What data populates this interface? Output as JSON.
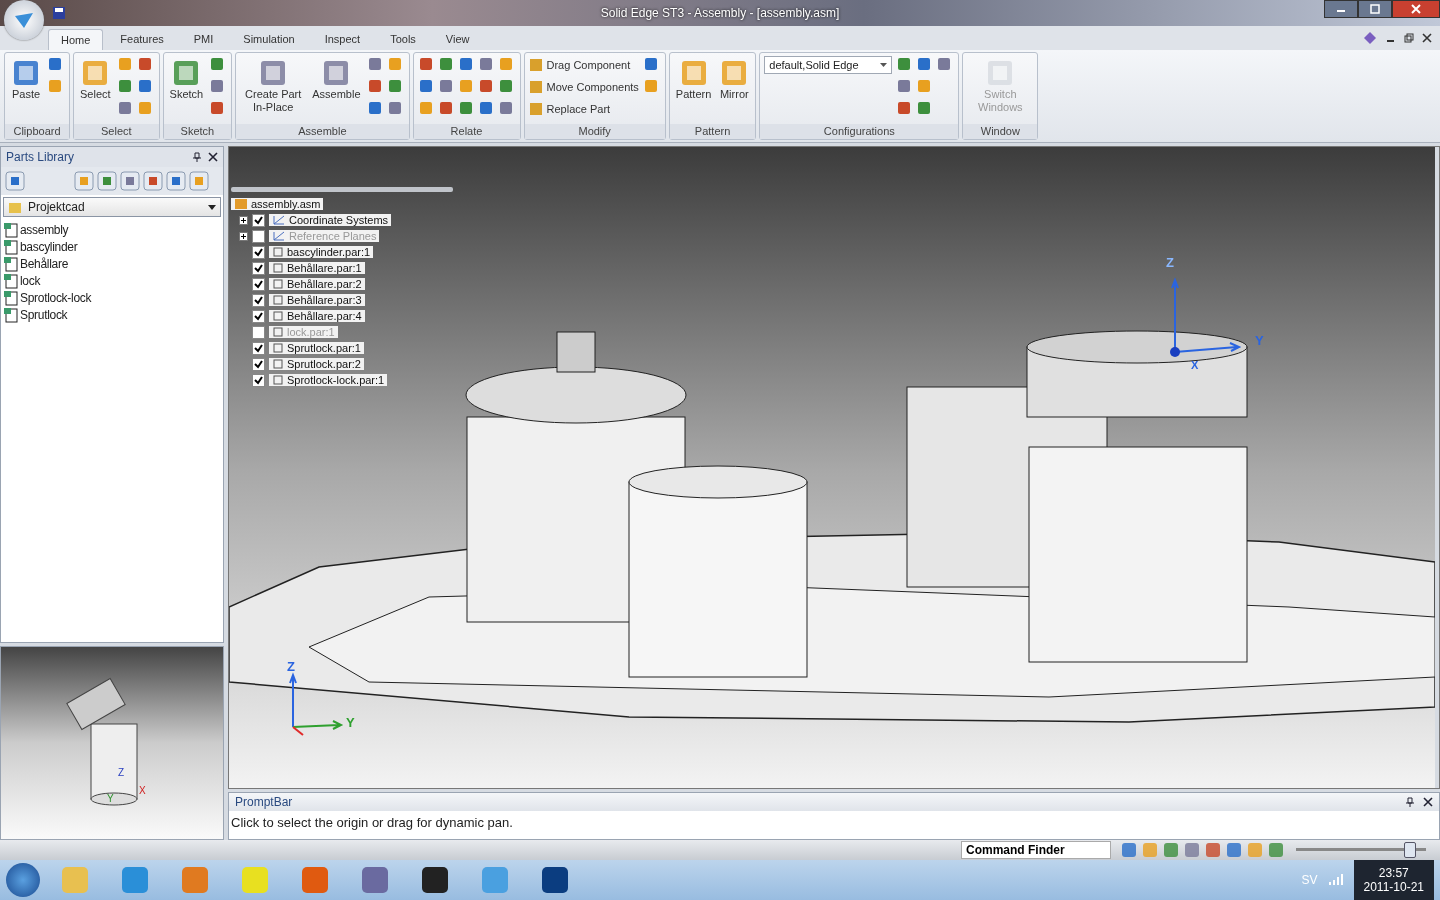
{
  "window": {
    "title": "Solid Edge ST3 - Assembly - [assembly.asm]"
  },
  "tabs": [
    {
      "label": "Home",
      "selected": true
    },
    {
      "label": "Features",
      "selected": false
    },
    {
      "label": "PMI",
      "selected": false
    },
    {
      "label": "Simulation",
      "selected": false
    },
    {
      "label": "Inspect",
      "selected": false
    },
    {
      "label": "Tools",
      "selected": false
    },
    {
      "label": "View",
      "selected": false
    }
  ],
  "ribbon_groups": [
    {
      "label": "Clipboard",
      "large_buttons": [
        {
          "label": "Paste",
          "disabled": false
        }
      ]
    },
    {
      "label": "Select",
      "large_buttons": [
        {
          "label": "Select",
          "disabled": false
        }
      ]
    },
    {
      "label": "Sketch",
      "large_buttons": [
        {
          "label": "Sketch",
          "disabled": false
        }
      ]
    },
    {
      "label": "Assemble",
      "large_buttons": [
        {
          "label": "Create Part In-Place",
          "disabled": false
        },
        {
          "label": "Assemble",
          "disabled": false
        }
      ]
    },
    {
      "label": "Relate"
    },
    {
      "label": "Modify",
      "commands": [
        "Drag Component",
        "Move Components",
        "Replace Part"
      ]
    },
    {
      "label": "Pattern",
      "large_buttons": [
        {
          "label": "Pattern",
          "disabled": false
        },
        {
          "label": "Mirror",
          "disabled": false
        }
      ]
    },
    {
      "label": "Configurations",
      "combo": "default,Solid Edge"
    },
    {
      "label": "Window",
      "large_buttons": [
        {
          "label": "Switch Windows",
          "disabled": true
        }
      ]
    }
  ],
  "parts_library": {
    "title": "Parts Library",
    "folder": "Projektcad",
    "files": [
      "assembly",
      "bascylinder",
      "Behållare",
      "lock",
      "Sprotlock-lock",
      "Sprutlock"
    ]
  },
  "assembly_tree": {
    "root": "assembly.asm",
    "items": [
      {
        "label": "Coordinate Systems",
        "kind": "group",
        "checked": true
      },
      {
        "label": "Reference Planes",
        "kind": "group",
        "checked": false
      },
      {
        "label": "bascylinder.par:1",
        "kind": "part",
        "checked": true
      },
      {
        "label": "Behållare.par:1",
        "kind": "part",
        "checked": true
      },
      {
        "label": "Behållare.par:2",
        "kind": "part",
        "checked": true
      },
      {
        "label": "Behållare.par:3",
        "kind": "part",
        "checked": true
      },
      {
        "label": "Behållare.par:4",
        "kind": "part",
        "checked": true
      },
      {
        "label": "lock.par:1",
        "kind": "part",
        "checked": false
      },
      {
        "label": "Sprutlock.par:1",
        "kind": "part",
        "checked": true
      },
      {
        "label": "Sprutlock.par:2",
        "kind": "part",
        "checked": true
      },
      {
        "label": "Sprotlock-lock.par:1",
        "kind": "part",
        "checked": true
      }
    ]
  },
  "viewport": {
    "triad_labels": [
      "Z",
      "Y",
      "X"
    ],
    "corner_triad_labels": [
      "Z",
      "Y"
    ]
  },
  "preview": {
    "triad_labels": [
      "Z",
      "Y",
      "X"
    ]
  },
  "prompt_bar": {
    "title": "PromptBar",
    "message": "Click to select the origin or drag for dynamic pan."
  },
  "status_bar": {
    "command_finder": "Command Finder",
    "zoom_slider": {
      "level": 0.87
    }
  },
  "taskbar": {
    "language": "SV",
    "time": "23:57",
    "date": "2011-10-21"
  }
}
